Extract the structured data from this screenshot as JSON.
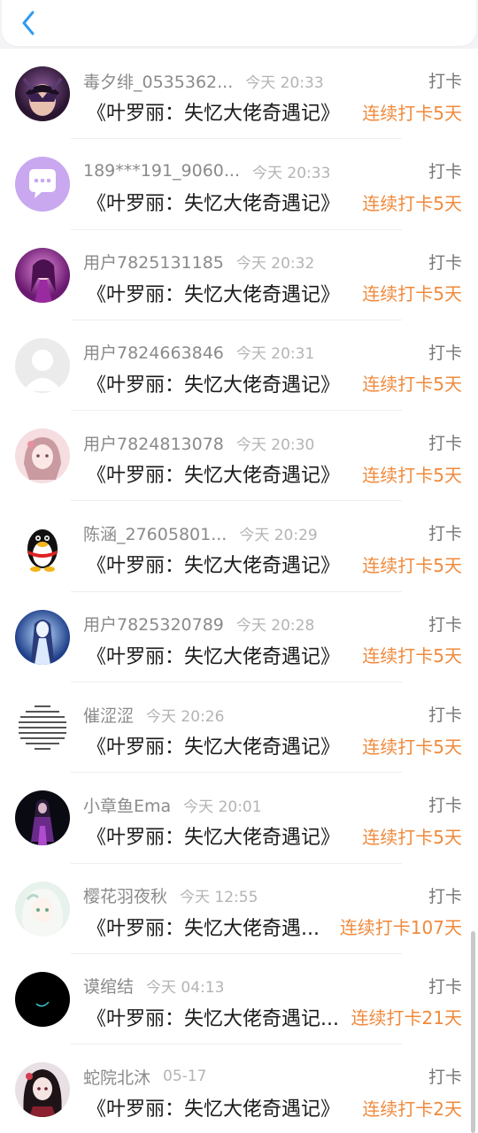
{
  "header": {
    "back_icon": "chevron-left-icon",
    "accent": "#2f9cf3"
  },
  "colors": {
    "streak": "#f08a3c",
    "name": "#8a8a8a",
    "time": "#b4b4b4"
  },
  "entries": [
    {
      "name": "毒夕绯_0535362...",
      "time": "今天 20:33",
      "action": "打卡",
      "book": "《叶罗丽：失忆大佬奇遇记》",
      "streak": "连续打卡5天",
      "avatar": "masked-figure-avatar"
    },
    {
      "name": "189***191_9060...",
      "time": "今天 20:33",
      "action": "打卡",
      "book": "《叶罗丽：失忆大佬奇遇记》",
      "streak": "连续打卡5天",
      "avatar": "chat-bubble-avatar"
    },
    {
      "name": "用户7825131185",
      "time": "今天 20:32",
      "action": "打卡",
      "book": "《叶罗丽：失忆大佬奇遇记》",
      "streak": "连续打卡5天",
      "avatar": "purple-character-avatar"
    },
    {
      "name": "用户7824663846",
      "time": "今天 20:31",
      "action": "打卡",
      "book": "《叶罗丽：失忆大佬奇遇记》",
      "streak": "连续打卡5天",
      "avatar": "default-user-avatar"
    },
    {
      "name": "用户7824813078",
      "time": "今天 20:30",
      "action": "打卡",
      "book": "《叶罗丽：失忆大佬奇遇记》",
      "streak": "连续打卡5天",
      "avatar": "anime-girl-avatar"
    },
    {
      "name": "陈涵_27605801...",
      "time": "今天 20:29",
      "action": "打卡",
      "book": "《叶罗丽：失忆大佬奇遇记》",
      "streak": "连续打卡5天",
      "avatar": "penguin-avatar"
    },
    {
      "name": "用户7825320789",
      "time": "今天 20:28",
      "action": "打卡",
      "book": "《叶罗丽：失忆大佬奇遇记》",
      "streak": "连续打卡5天",
      "avatar": "fairy-avatar"
    },
    {
      "name": "催涩涩",
      "time": "今天 20:26",
      "action": "打卡",
      "book": "《叶罗丽：失忆大佬奇遇记》",
      "streak": "连续打卡5天",
      "avatar": "text-circle-avatar"
    },
    {
      "name": "小章鱼Ema",
      "time": "今天 20:01",
      "action": "打卡",
      "book": "《叶罗丽：失忆大佬奇遇记》",
      "streak": "连续打卡5天",
      "avatar": "dark-figure-avatar"
    },
    {
      "name": "樱花羽夜秋",
      "time": "今天 12:55",
      "action": "打卡",
      "book": "《叶罗丽：失忆大佬奇遇...",
      "streak": "连续打卡107天",
      "avatar": "white-hair-girl-avatar"
    },
    {
      "name": "谟绾结",
      "time": "今天 04:13",
      "action": "打卡",
      "book": "《叶罗丽：失忆大佬奇遇记...",
      "streak": "连续打卡21天",
      "avatar": "black-circle-avatar"
    },
    {
      "name": "蛇院北沐",
      "time": "05-17",
      "action": "打卡",
      "book": "《叶罗丽：失忆大佬奇遇记》",
      "streak": "连续打卡2天",
      "avatar": "dark-hair-girl-avatar"
    }
  ]
}
